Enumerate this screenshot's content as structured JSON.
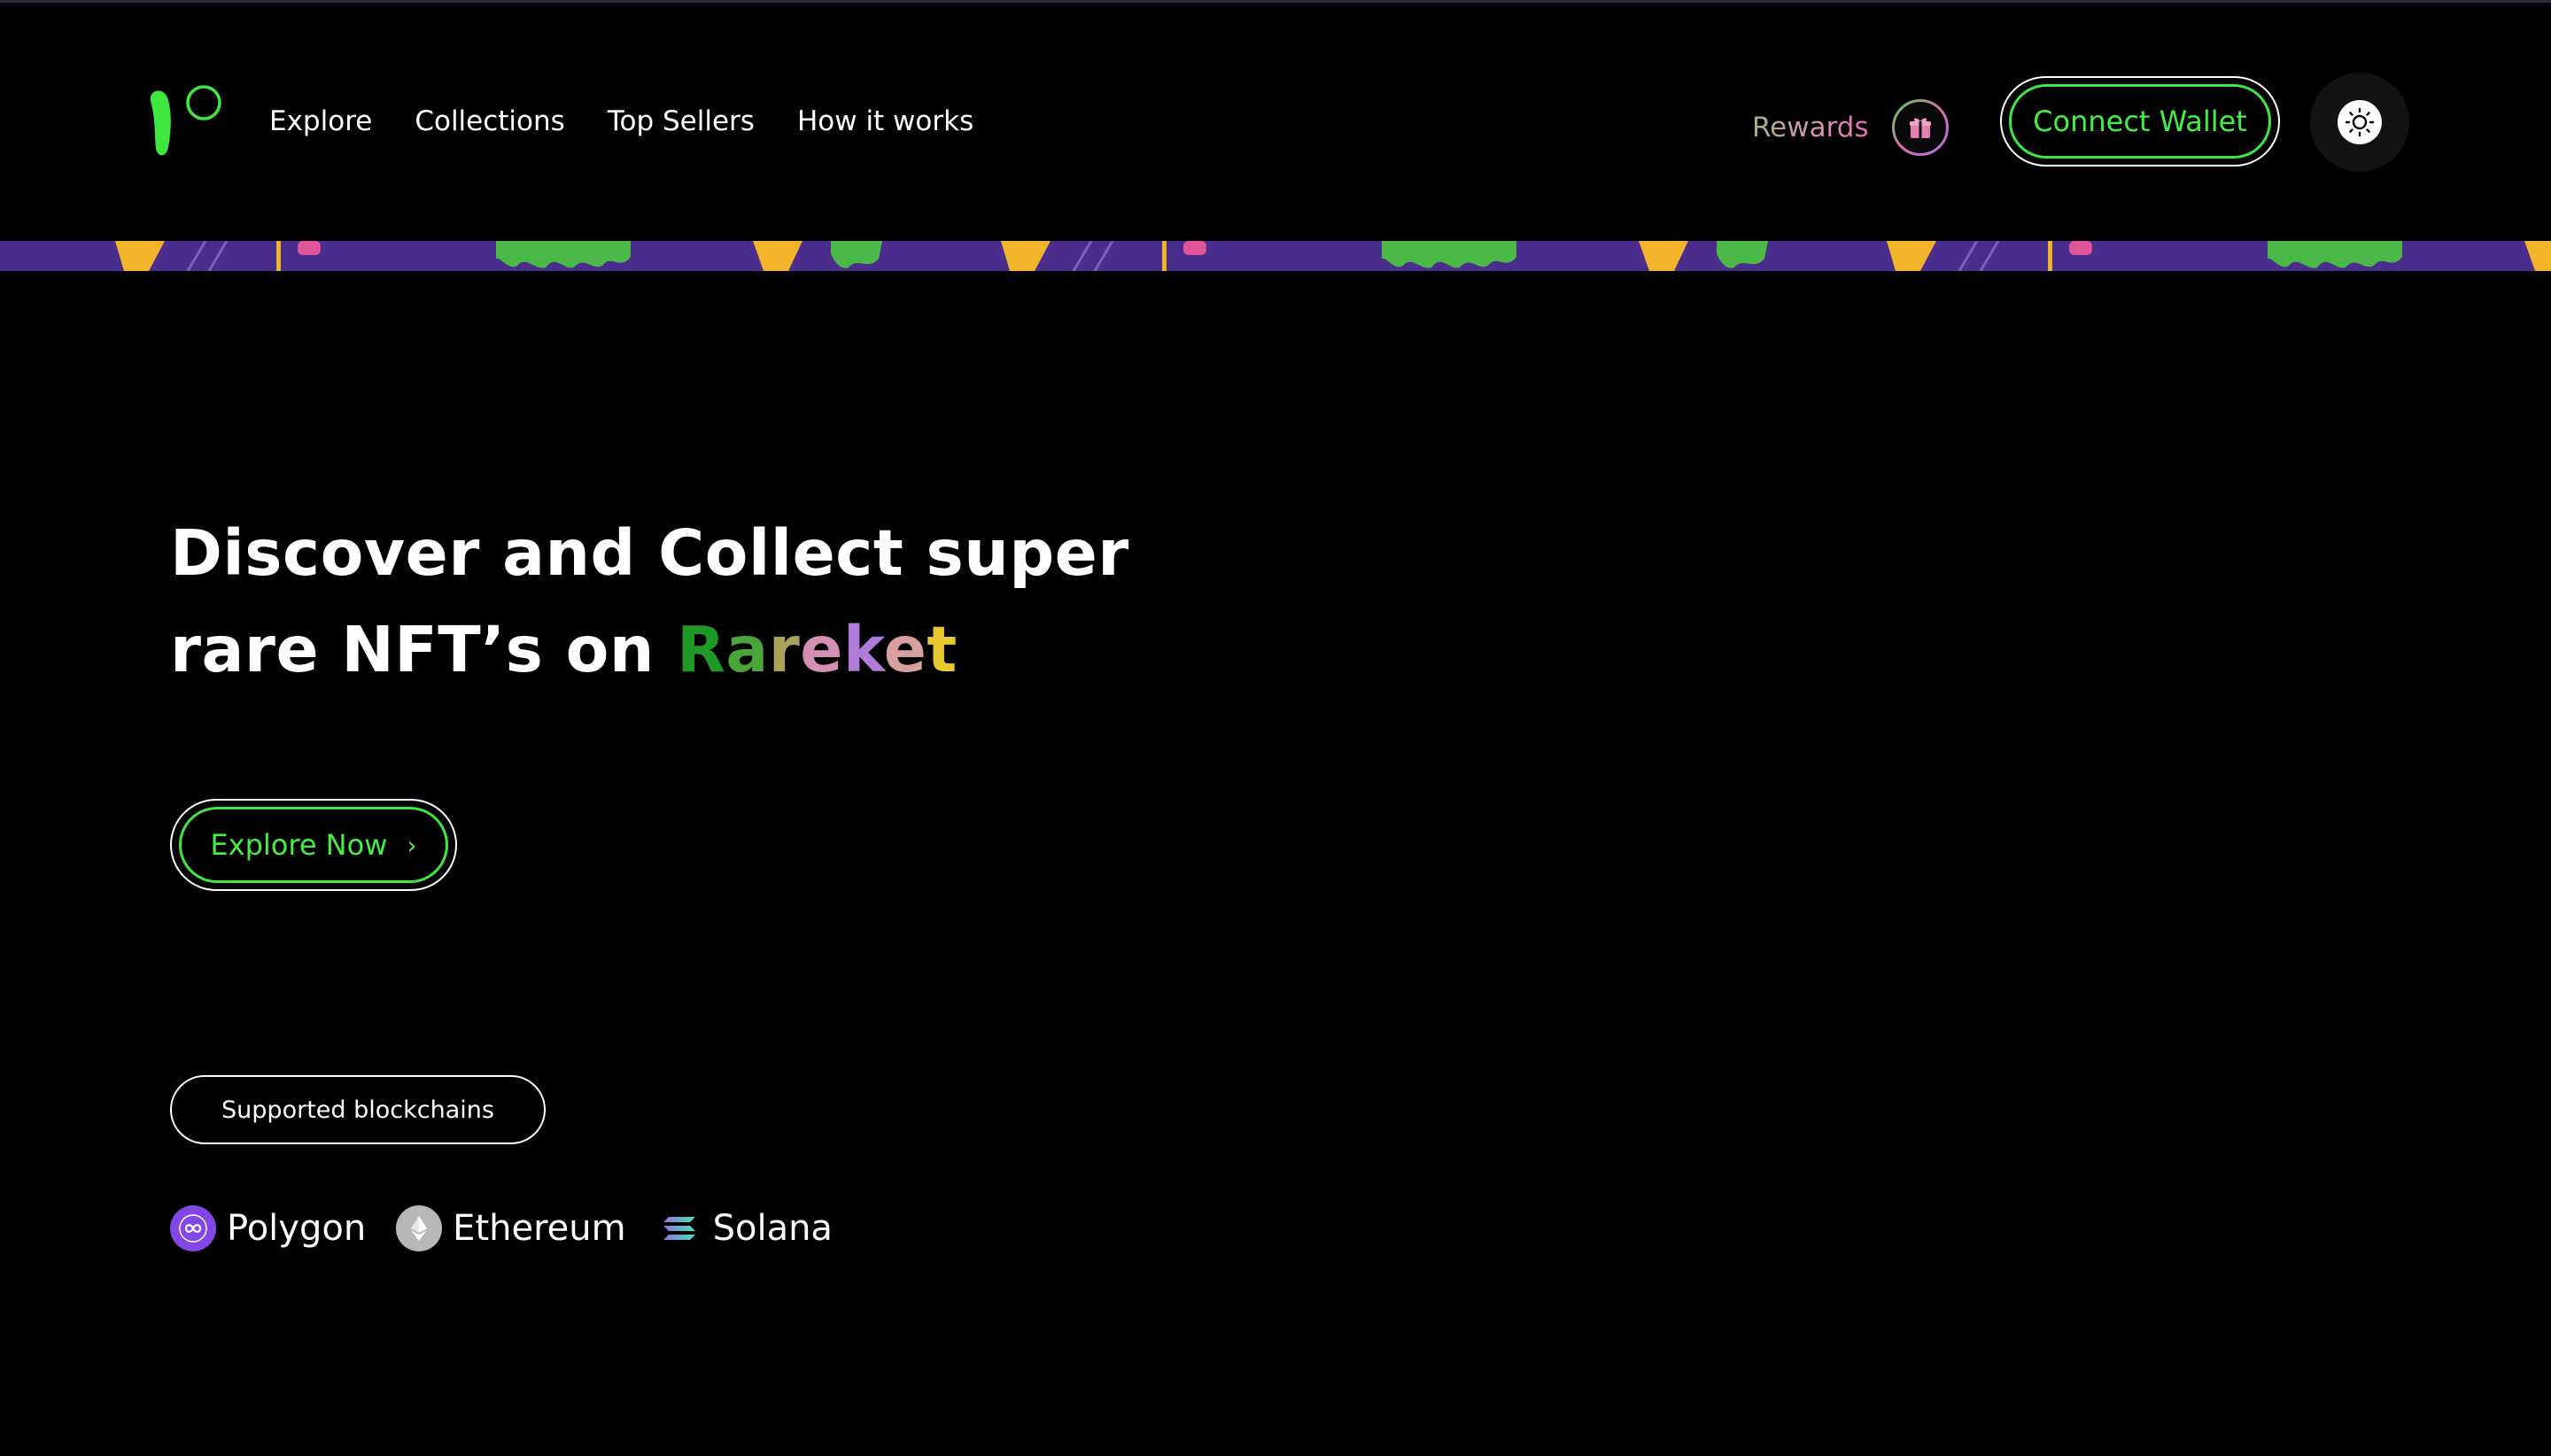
{
  "nav": {
    "logo_name": "rareket-logo",
    "links": [
      "Explore",
      "Collections",
      "Top Sellers",
      "How it works"
    ],
    "rewards_label": "Rewards",
    "rewards_icon": "gift-icon",
    "connect_wallet_label": "Connect Wallet",
    "theme_icon": "sun-icon"
  },
  "hero": {
    "title_line1": "Discover and Collect super",
    "title_line2_prefix": "rare NFT’s on ",
    "brand_letters": [
      "R",
      "a",
      "r",
      "e",
      "k",
      "e",
      "t"
    ],
    "explore_button_label": "Explore Now",
    "explore_icon": "chevron-right-icon"
  },
  "blockchains": {
    "label": "Supported blockchains",
    "items": [
      {
        "name": "Polygon",
        "icon": "polygon-icon"
      },
      {
        "name": "Ethereum",
        "icon": "ethereum-icon"
      },
      {
        "name": "Solana",
        "icon": "solana-icon"
      }
    ]
  },
  "colors": {
    "background": "#000000",
    "accent_green": "#3EE83E",
    "banner_purple": "#4A2D8C",
    "banner_yellow": "#F2B42A",
    "banner_green": "#4CB847",
    "banner_pink": "#E0559A"
  }
}
